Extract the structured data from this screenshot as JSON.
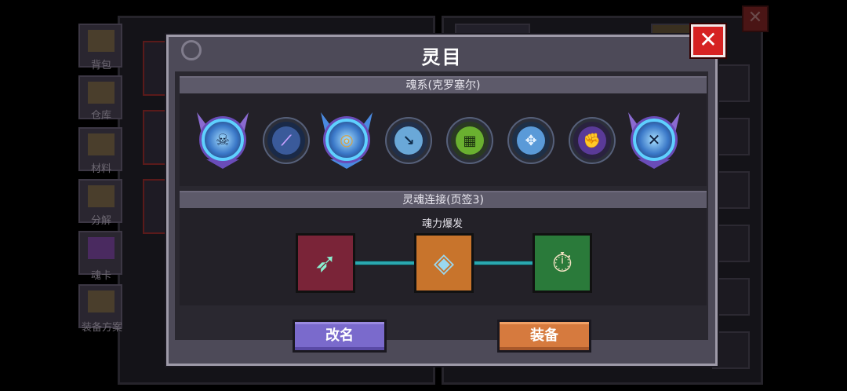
{
  "background": {
    "sidebar": [
      {
        "label": "背包"
      },
      {
        "label": "仓库"
      },
      {
        "label": "材料"
      },
      {
        "label": "分解"
      },
      {
        "label": "魂卡"
      },
      {
        "label": "装备方案"
      }
    ]
  },
  "modal": {
    "title": "灵目",
    "close_symbol": "✕",
    "soul_section": {
      "header": "魂系(克罗塞尔)",
      "orbs": [
        {
          "icon": "skull-crest-icon",
          "glyph": "☠",
          "color": "#5fd0ff"
        },
        {
          "icon": "blade-icon",
          "glyph": "⟋",
          "color": "#7a4ae0"
        },
        {
          "icon": "spiral-crest-icon",
          "glyph": "◎",
          "color": "#d8a040"
        },
        {
          "icon": "shovel-icon",
          "glyph": "↘",
          "color": "#6ac0ff"
        },
        {
          "icon": "rune-grid-icon",
          "glyph": "▦",
          "color": "#8ad040"
        },
        {
          "icon": "shuriken-icon",
          "glyph": "✥",
          "color": "#8ad0ff"
        },
        {
          "icon": "fist-icon",
          "glyph": "✊",
          "color": "#8a5ad8"
        },
        {
          "icon": "crossed-swords-crest-icon",
          "glyph": "✕",
          "color": "#5fd0ff"
        }
      ]
    },
    "link_section": {
      "header": "灵魂连接(页签3)",
      "center_caption": "魂力爆发",
      "nodes": [
        {
          "icon": "triple-arrows-icon",
          "glyph": "➶",
          "bg": "#7a2438"
        },
        {
          "icon": "crystal-shield-icon",
          "glyph": "◈",
          "bg": "#c8742c"
        },
        {
          "icon": "stopwatch-icon",
          "glyph": "⏱",
          "bg": "#2a7a3a"
        }
      ]
    },
    "buttons": {
      "rename": "改名",
      "equip": "装备"
    }
  }
}
